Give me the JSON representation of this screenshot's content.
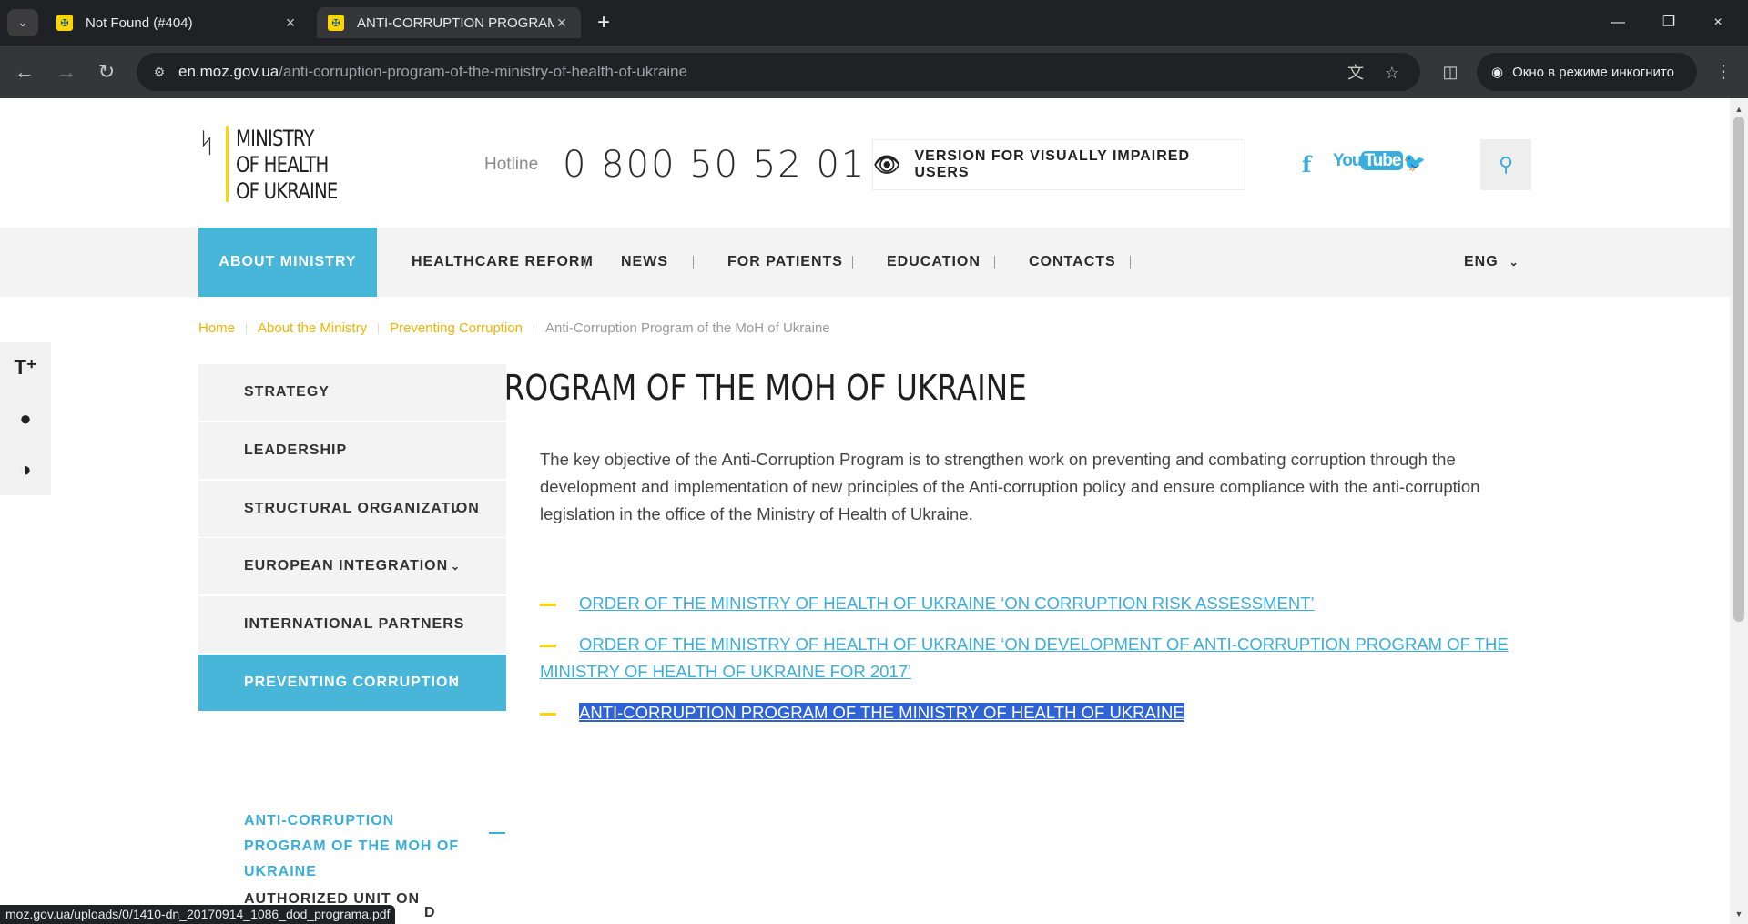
{
  "browser": {
    "tabs": [
      {
        "title": "Not Found (#404)"
      },
      {
        "title": "ANTI-CORRUPTION PROGRAM"
      }
    ],
    "url_domain": "en.moz.gov.ua",
    "url_path": "/anti-corruption-program-of-the-ministry-of-health-of-ukraine",
    "incognito_label": "Окно в режиме инкогнито",
    "status_url": "moz.gov.ua/uploads/0/1410-dn_20170914_1086_dod_programa.pdf"
  },
  "header": {
    "logo_lines": [
      "MINISTRY",
      "OF HEALTH",
      "OF UKRAINE"
    ],
    "hotline_label": "Hotline",
    "hotline_number": "0 800 50 52 01",
    "vision_label": "VERSION FOR VISUALLY IMPAIRED USERS",
    "social": {
      "facebook": "f",
      "youtube_a": "You",
      "youtube_b": "Tube",
      "twitter": "🐦"
    }
  },
  "nav": {
    "items": [
      "ABOUT MINISTRY",
      "HEALTHCARE REFORM",
      "NEWS",
      "FOR PATIENTS",
      "EDUCATION",
      "CONTACTS"
    ],
    "lang": "ENG"
  },
  "breadcrumbs": [
    "Home",
    "About the Ministry",
    "Preventing Corruption",
    "Anti-Corruption Program of the MoH of Ukraine"
  ],
  "page_title": "ANTI-CORRUPTION PROGRAM OF THE MOH OF UKRAINE",
  "sidebar": {
    "items": [
      "STRATEGY",
      "LEADERSHIP",
      "STRUCTURAL ORGANIZATION",
      "EUROPEAN INTEGRATION",
      "INTERNATIONAL PARTNERS",
      "PREVENTING CORRUPTION"
    ],
    "sub_current": "ANTI-CORRUPTION PROGRAM OF THE MOH OF UKRAINE",
    "sub_next": "AUTHORIZED UNIT ON",
    "sub_peek": "D"
  },
  "content": {
    "intro": "The key objective of the Anti-Corruption Program is to strengthen work on preventing and combating corruption through the development and implementation of new principles of the Anti-corruption policy and ensure compliance with the anti-corruption legislation in the office of the Ministry of Health of Ukraine.",
    "documents": [
      "ORDER OF THE MINISTRY OF HEALTH OF UKRAINE ‘ON CORRUPTION RISK ASSESSMENT’",
      "ORDER OF THE MINISTRY OF HEALTH OF UKRAINE ‘ON DEVELOPMENT OF ANTI-CORRUPTION PROGRAM OF THE MINISTRY OF HEALTH OF UKRAINE FOR 2017’",
      "ANTI-CORRUPTION PROGRAM OF THE MINISTRY OF HEALTH OF UKRAINE"
    ]
  },
  "colors": {
    "accent": "#47b6d8",
    "link": "#3aaed8",
    "crumb": "#f0b400",
    "dash": "#ffd500",
    "selection": "#2f62d4"
  }
}
